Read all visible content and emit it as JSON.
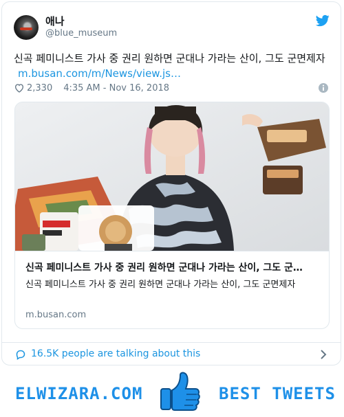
{
  "tweet": {
    "display_name": "애나",
    "handle": "@blue_museum",
    "text": "신곡 페미니스트 가사 중 권리 원하면 군대나 가라는 산이, 그도 군면제자",
    "link_text": "m.busan.com/m/News/view.js…",
    "likes": "2,330",
    "timestamp": "4:35 AM - Nov 16, 2018"
  },
  "link_card": {
    "image_alt": "person in camouflage sweater holding food packages",
    "title": "신곡 페미니스트 가사 중 권리 원하면 군대나 가라는 산이, 그도 군…",
    "description": "신곡 페미니스트 가사 중 권리 원하면 군대나 가라는 산이, 그도 군면제자",
    "domain": "m.busan.com"
  },
  "footer_bar": {
    "talking": "16.5K people are talking about this"
  },
  "branding": {
    "left_text": "ELWIZARA.COM",
    "right_text": "BEST TWEETS"
  },
  "colors": {
    "accent": "#1b95e0",
    "muted": "#657786",
    "brand": "#1e90e8"
  },
  "icons": [
    "twitter-bird-icon",
    "heart-icon",
    "info-icon",
    "speech-bubble-icon",
    "chevron-right-icon",
    "thumbs-up-icon"
  ]
}
